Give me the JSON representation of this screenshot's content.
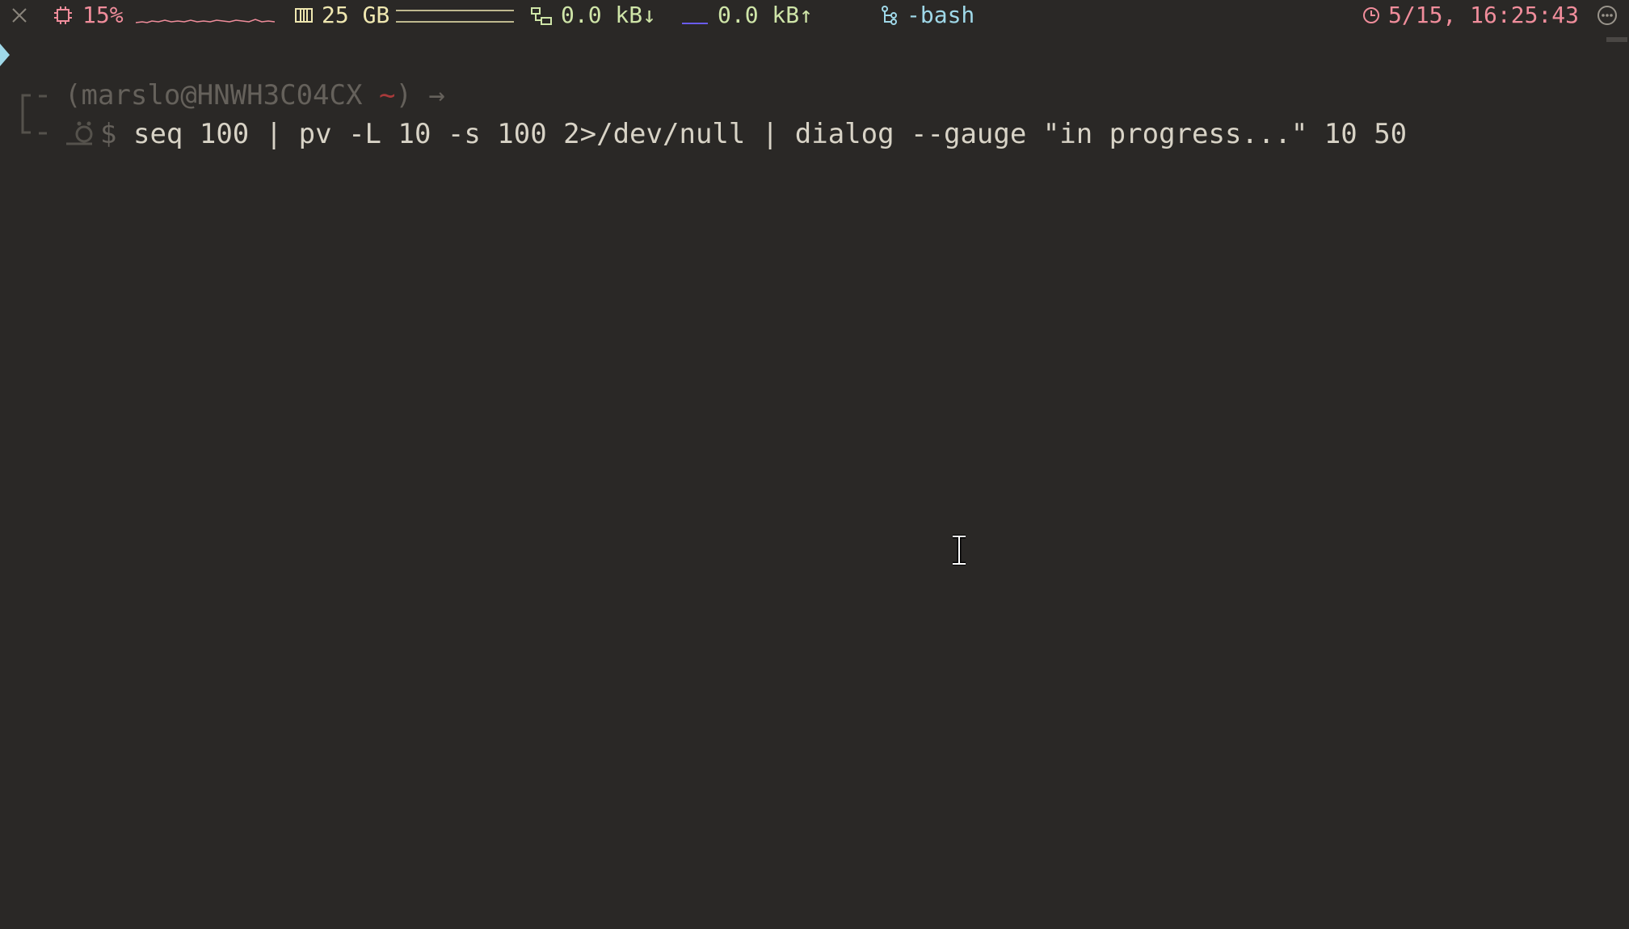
{
  "statusbar": {
    "cpu": {
      "icon": "cpu-icon",
      "value": "15%",
      "color": "#f08d9b"
    },
    "memory": {
      "icon": "memory-icon",
      "value": "25 GB",
      "color": "#efe7b0"
    },
    "network_down": {
      "icon": "network-icon",
      "value": "0.0 kB↓",
      "color": "#cfe5a8"
    },
    "network_up": {
      "value": "0.0 kB↑",
      "color": "#cfe5a8"
    },
    "job": {
      "icon": "process-icon",
      "value": "-bash",
      "color": "#9fd8e8"
    },
    "clock": {
      "icon": "clock-icon",
      "value": "5/15, 16:25:43",
      "color": "#f08d9b"
    }
  },
  "terminal": {
    "prompt": {
      "open_paren": "(",
      "user_host": "marslo@HNWH3C04CX",
      "tilde": "~",
      "close_paren": ")",
      "arrow": "→",
      "dollar": "$"
    },
    "command": "seq 100 | pv -L 10 -s 100 2>/dev/null | dialog --gauge \"in progress...\" 10 50"
  }
}
